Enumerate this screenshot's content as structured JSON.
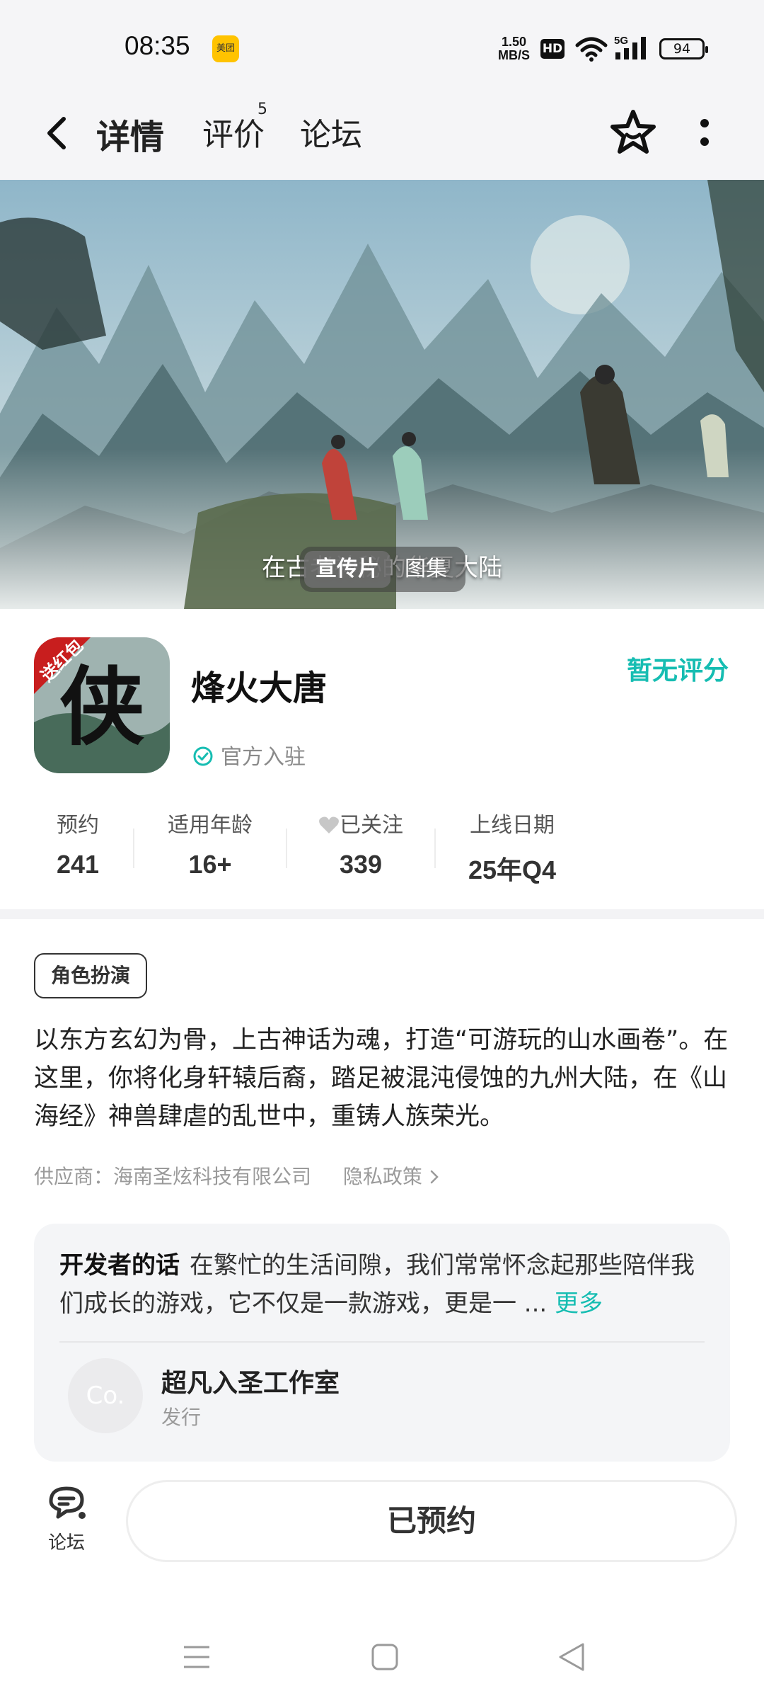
{
  "status_bar": {
    "time": "08:35",
    "app_badge": "美团",
    "net_speed_value": "1.50",
    "net_speed_unit": "MB/S",
    "hd": "HD",
    "network": "5G",
    "battery": "94"
  },
  "header": {
    "tabs": [
      {
        "label": "详情",
        "active": true
      },
      {
        "label": "评价",
        "badge": "5"
      },
      {
        "label": "论坛"
      }
    ],
    "accent_color": "#16c2b8"
  },
  "hero": {
    "subtitle": "在古老神秘的华夏大陆",
    "media_tabs": [
      "宣传片",
      "图集"
    ]
  },
  "game": {
    "icon_text": "侠",
    "icon_ribbon": "送红包",
    "title": "烽火大唐",
    "rating": "暂无评分",
    "official": "官方入驻"
  },
  "stats": [
    {
      "label": "预约",
      "value": "241"
    },
    {
      "label": "适用年龄",
      "value": "16+"
    },
    {
      "label": "已关注",
      "value": "339"
    },
    {
      "label": "上线日期",
      "value": "25年Q4"
    }
  ],
  "tag": "角色扮演",
  "description": "以东方玄幻为骨，上古神话为魂，打造“可游玩的山水画卷”。在这里，你将化身轩辕后裔，踏足被混沌侵蚀的九州大陆，在《山海经》神兽肆虐的乱世中，重铸人族荣光。",
  "vendor": {
    "label": "供应商：海南圣炫科技有限公司",
    "privacy": "隐私政策"
  },
  "developer": {
    "title": "开发者的话",
    "text": "在繁忙的生活间隙，我们常常怀念起那些陪伴我们成长的游戏，它不仅是一款游戏，更是一 ...",
    "more": "更多",
    "avatar_text": "Co.",
    "studio": "超凡入圣工作室",
    "role": "发行"
  },
  "bottom": {
    "forum_label": "论坛",
    "reserve_label": "已预约"
  }
}
